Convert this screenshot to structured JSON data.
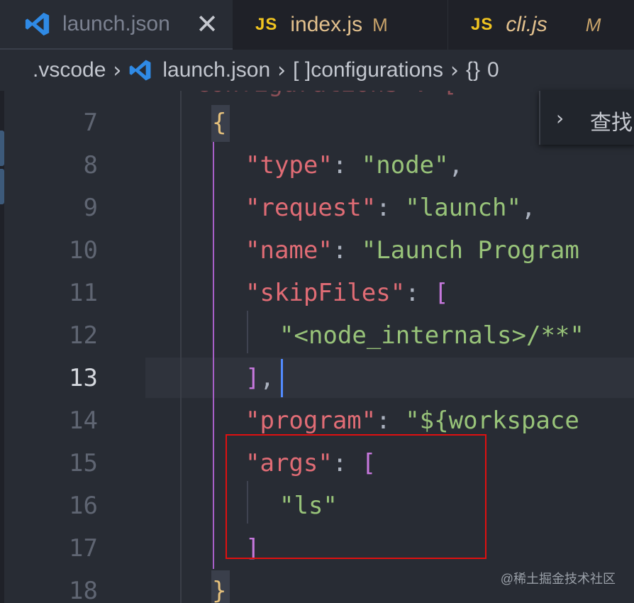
{
  "tabs": [
    {
      "label": "launch.json",
      "badge": "",
      "icon": "vscode-icon",
      "active": true,
      "italic": false,
      "close": "✕"
    },
    {
      "label": "index.js",
      "badge": "M",
      "icon": "js-icon",
      "icon_text": "JS",
      "active": false,
      "italic": false
    },
    {
      "label": "cli.js",
      "badge": "M",
      "icon": "js-icon",
      "icon_text": "JS",
      "active": false,
      "italic": true
    }
  ],
  "breadcrumb": {
    "folder": ".vscode",
    "file": "launch.json",
    "array_icon": "[ ]",
    "array": "configurations",
    "object_icon": "{}",
    "object": "0"
  },
  "find_widget": {
    "chevron": "›",
    "label": "查找"
  },
  "editor": {
    "current_line": "13",
    "lines": [
      {
        "no": "7",
        "code": "{"
      },
      {
        "no": "8",
        "code": "\"type\": \"node\","
      },
      {
        "no": "9",
        "code": "\"request\": \"launch\","
      },
      {
        "no": "10",
        "code": "\"name\": \"Launch Program"
      },
      {
        "no": "11",
        "code": "\"skipFiles\": ["
      },
      {
        "no": "12",
        "code": "\"<node_internals>/**\""
      },
      {
        "no": "13",
        "code": "],"
      },
      {
        "no": "14",
        "code": "\"program\": \"${workspace"
      },
      {
        "no": "15",
        "code": "\"args\": ["
      },
      {
        "no": "16",
        "code": "\"ls\""
      },
      {
        "no": "17",
        "code": "]"
      },
      {
        "no": "18",
        "code": "}"
      }
    ]
  },
  "watermark": "@稀土掘金技术社区",
  "colors": {
    "key": "#e06c75",
    "string": "#98c379",
    "bracket": "#c678dd",
    "brace": "#e5c07b",
    "highlight_box": "#e01010",
    "accent": "#528bff"
  }
}
